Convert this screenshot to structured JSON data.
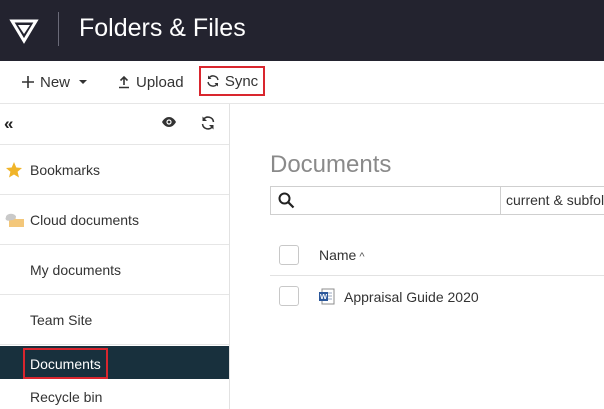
{
  "header": {
    "title": "Folders & Files"
  },
  "toolbar": {
    "new_label": "New",
    "upload_label": "Upload",
    "sync_label": "Sync"
  },
  "sidebar": {
    "collapse_glyph": "«",
    "items": [
      {
        "label": "Bookmarks",
        "icon": "star-icon"
      },
      {
        "label": "Cloud documents",
        "icon": "cloud-folder-icon"
      },
      {
        "label": "My documents"
      },
      {
        "label": "Team Site"
      },
      {
        "label": "Documents",
        "active": true
      },
      {
        "label": "Recycle bin"
      }
    ]
  },
  "main": {
    "title": "Documents",
    "search": {
      "placeholder": "",
      "scope": "current & subfol"
    },
    "columns": [
      {
        "label": "Name",
        "sort": "ascending"
      }
    ],
    "files": [
      {
        "name": "Appraisal Guide 2020",
        "type": "word-document"
      }
    ]
  },
  "colors": {
    "header_bg": "#23232f",
    "active_bg": "#18303d",
    "highlight": "#d9262e",
    "star": "#f0b429",
    "word_blue": "#2b579a"
  }
}
